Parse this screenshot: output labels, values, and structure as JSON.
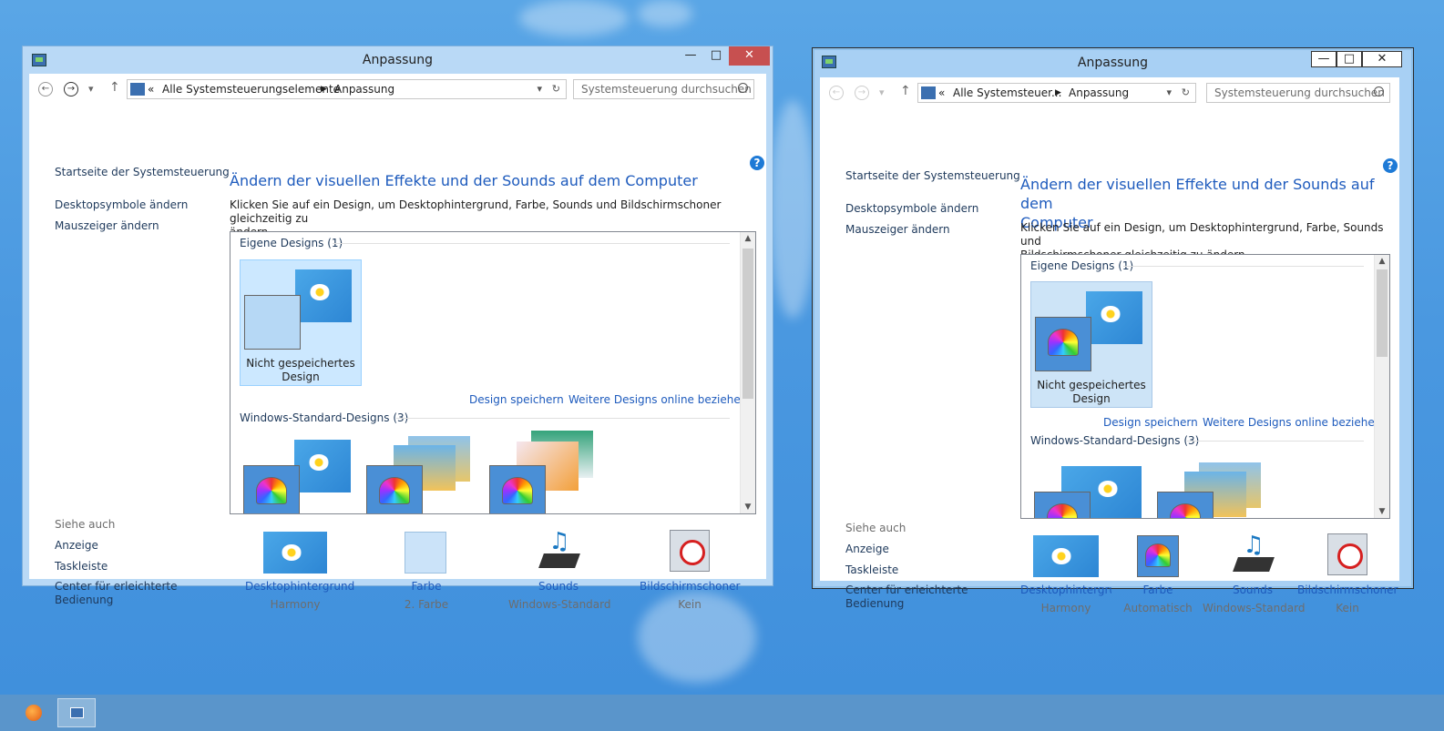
{
  "window_left": {
    "title": "Anpassung",
    "breadcrumbs": [
      "Alle Systemsteuerungselemente",
      "Anpassung"
    ],
    "search_placeholder": "Systemsteuerung durchsuchen",
    "sidebar": {
      "home": "Startseite der Systemsteuerung",
      "links": [
        "Desktopsymbole ändern",
        "Mauszeiger ändern"
      ],
      "see_also": "Siehe auch",
      "see_also_links": [
        "Anzeige",
        "Taskleiste",
        "Center für erleichterte",
        "Bedienung"
      ]
    },
    "heading": "Ändern der visuellen Effekte und der Sounds auf dem Computer",
    "description_1": "Klicken Sie auf ein Design, um Desktophintergrund, Farbe, Sounds und Bildschirmschoner gleichzeitig zu",
    "description_2": "ändern.",
    "group_own": "Eigene Designs (1)",
    "tile_label_1": "Nicht gespeichertes",
    "tile_label_2": "Design",
    "link_save": "Design speichern",
    "link_more": "Weitere Designs online beziehen",
    "group_std": "Windows-Standard-Designs (3)",
    "bottom": [
      {
        "label": "Desktophintergrund",
        "sub": "Harmony"
      },
      {
        "label": "Farbe",
        "sub": "2. Farbe"
      },
      {
        "label": "Sounds",
        "sub": "Windows-Standard"
      },
      {
        "label": "Bildschirmschoner",
        "sub": "Kein"
      }
    ]
  },
  "window_right": {
    "title": "Anpassung",
    "breadcrumbs": [
      "Alle Systemsteuer...",
      "Anpassung"
    ],
    "search_placeholder": "Systemsteuerung durchsuchen",
    "sidebar": {
      "home": "Startseite der Systemsteuerung",
      "links": [
        "Desktopsymbole ändern",
        "Mauszeiger ändern"
      ],
      "see_also": "Siehe auch",
      "see_also_links": [
        "Anzeige",
        "Taskleiste",
        "Center für erleichterte",
        "Bedienung"
      ]
    },
    "heading_1": "Ändern der visuellen Effekte und der Sounds auf dem",
    "heading_2": "Computer",
    "description_1": "Klicken Sie auf ein Design, um Desktophintergrund, Farbe, Sounds und",
    "description_2": "Bildschirmschoner gleichzeitig zu ändern.",
    "group_own": "Eigene Designs (1)",
    "tile_label_1": "Nicht gespeichertes",
    "tile_label_2": "Design",
    "link_save": "Design speichern",
    "link_more": "Weitere Designs online beziehen",
    "group_std": "Windows-Standard-Designs (3)",
    "bottom": [
      {
        "label": "Desktophintergrund",
        "sub": "Harmony"
      },
      {
        "label": "Farbe",
        "sub": "Automatisch"
      },
      {
        "label": "Sounds",
        "sub": "Windows-Standard"
      },
      {
        "label": "Bildschirmschoner",
        "sub": "Kein"
      }
    ]
  },
  "colors": {
    "link": "#1e5bbd",
    "close_button": "#c75050",
    "selection": "#cce8ff"
  }
}
